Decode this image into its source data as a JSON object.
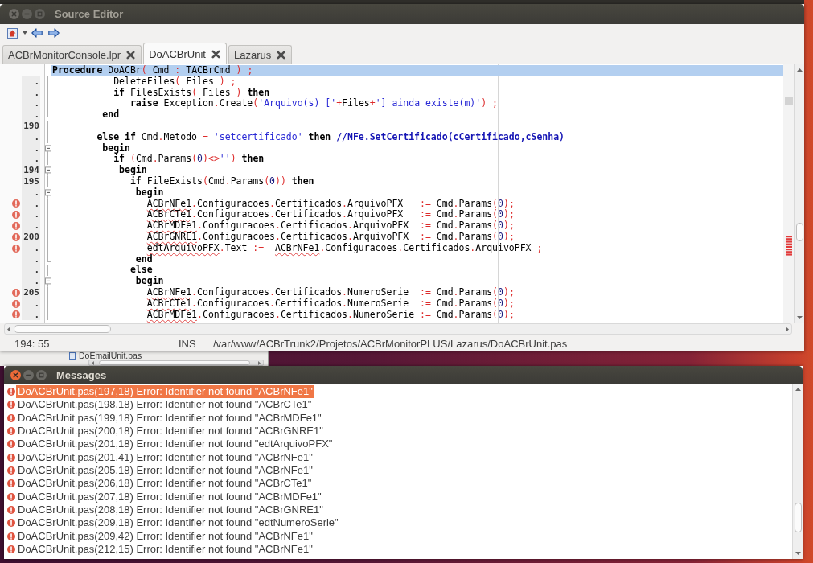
{
  "editor_window": {
    "title": "Source Editor",
    "active": false,
    "tabs": [
      {
        "label": "ACBrMonitorConsole.lpr",
        "selected": false
      },
      {
        "label": "DoACBrUnit",
        "selected": true
      },
      {
        "label": "Lazarus",
        "selected": false
      }
    ],
    "lines": [
      {
        "kind": "plain",
        "error": false,
        "highlighted": true,
        "tokens": [
          {
            "kind": "kw",
            "text": "Procedure"
          },
          {
            "kind": "id",
            "text": " DoACBr"
          },
          {
            "kind": "sym",
            "text": "("
          },
          {
            "kind": "id",
            "text": " Cmd "
          },
          {
            "kind": "sym",
            "text": ":"
          },
          {
            "kind": "id",
            "text": " TACBrCmd "
          },
          {
            "kind": "sym",
            "text": ") ;"
          }
        ]
      },
      {
        "kind": "fold_line",
        "number": ".",
        "error": false,
        "highlighted": false,
        "tokens": [
          {
            "kind": "id",
            "text": "           DeleteFiles"
          },
          {
            "kind": "sym",
            "text": "("
          },
          {
            "kind": "id",
            "text": " Files "
          },
          {
            "kind": "sym",
            "text": ") ;"
          }
        ]
      },
      {
        "kind": "fold_line",
        "number": ".",
        "error": false,
        "highlighted": false,
        "tokens": [
          {
            "kind": "kw",
            "text": "           if"
          },
          {
            "kind": "id",
            "text": " FilesExists"
          },
          {
            "kind": "sym",
            "text": "("
          },
          {
            "kind": "id",
            "text": " Files "
          },
          {
            "kind": "sym",
            "text": ")"
          },
          {
            "kind": "kw",
            "text": " then"
          }
        ]
      },
      {
        "kind": "fold_line",
        "number": ".",
        "error": false,
        "highlighted": false,
        "tokens": [
          {
            "kind": "kw",
            "text": "              raise"
          },
          {
            "kind": "id",
            "text": " Exception"
          },
          {
            "kind": "sym",
            "text": "."
          },
          {
            "kind": "id",
            "text": "Create"
          },
          {
            "kind": "sym",
            "text": "("
          },
          {
            "kind": "str",
            "text": "'Arquivo(s) ['"
          },
          {
            "kind": "sym",
            "text": "+"
          },
          {
            "kind": "id",
            "text": "Files"
          },
          {
            "kind": "sym",
            "text": "+"
          },
          {
            "kind": "str",
            "text": "'] ainda existe(m)'"
          },
          {
            "kind": "sym",
            "text": ") ;"
          }
        ]
      },
      {
        "kind": "fold_end",
        "number": ".",
        "error": false,
        "highlighted": false,
        "tokens": [
          {
            "kind": "kw",
            "text": "         end"
          }
        ]
      },
      {
        "kind": "fold_line",
        "number": "190",
        "error": false,
        "highlighted": false
      },
      {
        "kind": "fold_line",
        "number": ".",
        "error": false,
        "highlighted": false,
        "tokens": [
          {
            "kind": "kw",
            "text": "        else if"
          },
          {
            "kind": "id",
            "text": " Cmd"
          },
          {
            "kind": "sym",
            "text": "."
          },
          {
            "kind": "id",
            "text": "Metodo"
          },
          {
            "kind": "sym",
            "text": " ="
          },
          {
            "kind": "str",
            "text": " 'setcertificado'"
          },
          {
            "kind": "kw",
            "text": " then"
          },
          {
            "kind": "cmt",
            "text": " //NFe.SetCertificado(cCertificado,cSenha)"
          }
        ]
      },
      {
        "kind": "fold_start",
        "number": ".",
        "error": false,
        "highlighted": false,
        "tokens": [
          {
            "kind": "kw",
            "text": "         begin"
          }
        ]
      },
      {
        "kind": "fold_line",
        "number": ".",
        "error": false,
        "highlighted": false,
        "tokens": [
          {
            "kind": "kw",
            "text": "           if"
          },
          {
            "kind": "sym",
            "text": " ("
          },
          {
            "kind": "id",
            "text": "Cmd"
          },
          {
            "kind": "sym",
            "text": "."
          },
          {
            "kind": "id",
            "text": "Params"
          },
          {
            "kind": "sym",
            "text": "("
          },
          {
            "kind": "num",
            "text": "0"
          },
          {
            "kind": "sym",
            "text": ")<>"
          },
          {
            "kind": "str",
            "text": "''"
          },
          {
            "kind": "sym",
            "text": ")"
          },
          {
            "kind": "kw",
            "text": " then"
          }
        ]
      },
      {
        "kind": "fold_start",
        "number": "194",
        "error": false,
        "highlighted": false,
        "tokens": [
          {
            "kind": "kw",
            "text": "            begin"
          }
        ]
      },
      {
        "kind": "fold_line",
        "number": "195",
        "error": false,
        "highlighted": false,
        "tokens": [
          {
            "kind": "kw",
            "text": "              if"
          },
          {
            "kind": "id",
            "text": " FileExists"
          },
          {
            "kind": "sym",
            "text": "("
          },
          {
            "kind": "id",
            "text": "Cmd"
          },
          {
            "kind": "sym",
            "text": "."
          },
          {
            "kind": "id",
            "text": "Params"
          },
          {
            "kind": "sym",
            "text": "("
          },
          {
            "kind": "num",
            "text": "0"
          },
          {
            "kind": "sym",
            "text": "))"
          },
          {
            "kind": "kw",
            "text": " then"
          }
        ]
      },
      {
        "kind": "fold_start",
        "number": ".",
        "error": false,
        "highlighted": false,
        "tokens": [
          {
            "kind": "kw",
            "text": "               begin"
          }
        ]
      },
      {
        "kind": "fold_line",
        "number": ".",
        "error": true,
        "highlighted": false,
        "tokens": [
          {
            "kind": "err",
            "text": "                 ACBrNFe1"
          },
          {
            "kind": "sym",
            "text": "."
          },
          {
            "kind": "id",
            "text": "Configuracoes"
          },
          {
            "kind": "sym",
            "text": "."
          },
          {
            "kind": "id",
            "text": "Certificados"
          },
          {
            "kind": "sym",
            "text": "."
          },
          {
            "kind": "id",
            "text": "ArquivoPFX   "
          },
          {
            "kind": "sym",
            "text": ":="
          },
          {
            "kind": "id",
            "text": " Cmd"
          },
          {
            "kind": "sym",
            "text": "."
          },
          {
            "kind": "id",
            "text": "Params"
          },
          {
            "kind": "sym",
            "text": "("
          },
          {
            "kind": "num",
            "text": "0"
          },
          {
            "kind": "sym",
            "text": ");"
          }
        ]
      },
      {
        "kind": "fold_line",
        "number": ".",
        "error": true,
        "highlighted": false,
        "tokens": [
          {
            "kind": "err",
            "text": "                 ACBrCTe1"
          },
          {
            "kind": "sym",
            "text": "."
          },
          {
            "kind": "id",
            "text": "Configuracoes"
          },
          {
            "kind": "sym",
            "text": "."
          },
          {
            "kind": "id",
            "text": "Certificados"
          },
          {
            "kind": "sym",
            "text": "."
          },
          {
            "kind": "id",
            "text": "ArquivoPFX   "
          },
          {
            "kind": "sym",
            "text": ":="
          },
          {
            "kind": "id",
            "text": " Cmd"
          },
          {
            "kind": "sym",
            "text": "."
          },
          {
            "kind": "id",
            "text": "Params"
          },
          {
            "kind": "sym",
            "text": "("
          },
          {
            "kind": "num",
            "text": "0"
          },
          {
            "kind": "sym",
            "text": ");"
          }
        ]
      },
      {
        "kind": "fold_line",
        "number": ".",
        "error": true,
        "highlighted": false,
        "tokens": [
          {
            "kind": "err",
            "text": "                 ACBrMDFe1"
          },
          {
            "kind": "sym",
            "text": "."
          },
          {
            "kind": "id",
            "text": "Configuracoes"
          },
          {
            "kind": "sym",
            "text": "."
          },
          {
            "kind": "id",
            "text": "Certificados"
          },
          {
            "kind": "sym",
            "text": "."
          },
          {
            "kind": "id",
            "text": "ArquivoPFX  "
          },
          {
            "kind": "sym",
            "text": ":="
          },
          {
            "kind": "id",
            "text": " Cmd"
          },
          {
            "kind": "sym",
            "text": "."
          },
          {
            "kind": "id",
            "text": "Params"
          },
          {
            "kind": "sym",
            "text": "("
          },
          {
            "kind": "num",
            "text": "0"
          },
          {
            "kind": "sym",
            "text": ");"
          }
        ]
      },
      {
        "kind": "fold_line",
        "number": "200",
        "error": true,
        "highlighted": false,
        "tokens": [
          {
            "kind": "err",
            "text": "                 ACBrGNRE1"
          },
          {
            "kind": "sym",
            "text": "."
          },
          {
            "kind": "id",
            "text": "Configuracoes"
          },
          {
            "kind": "sym",
            "text": "."
          },
          {
            "kind": "id",
            "text": "Certificados"
          },
          {
            "kind": "sym",
            "text": "."
          },
          {
            "kind": "id",
            "text": "ArquivoPFX  "
          },
          {
            "kind": "sym",
            "text": ":="
          },
          {
            "kind": "id",
            "text": " Cmd"
          },
          {
            "kind": "sym",
            "text": "."
          },
          {
            "kind": "id",
            "text": "Params"
          },
          {
            "kind": "sym",
            "text": "("
          },
          {
            "kind": "num",
            "text": "0"
          },
          {
            "kind": "sym",
            "text": ");"
          }
        ]
      },
      {
        "kind": "fold_line",
        "number": ".",
        "error": true,
        "highlighted": false,
        "tokens": [
          {
            "kind": "err",
            "text": "                 edtArquivoPFX"
          },
          {
            "kind": "sym",
            "text": "."
          },
          {
            "kind": "id",
            "text": "Text "
          },
          {
            "kind": "sym",
            "text": ":=  "
          },
          {
            "kind": "err",
            "text": "ACBrNFe1"
          },
          {
            "kind": "sym",
            "text": "."
          },
          {
            "kind": "id",
            "text": "Configuracoes"
          },
          {
            "kind": "sym",
            "text": "."
          },
          {
            "kind": "id",
            "text": "Certificados"
          },
          {
            "kind": "sym",
            "text": "."
          },
          {
            "kind": "id",
            "text": "ArquivoPFX"
          },
          {
            "kind": "sym",
            "text": " ;"
          }
        ]
      },
      {
        "kind": "fold_end",
        "number": ".",
        "error": false,
        "highlighted": false,
        "tokens": [
          {
            "kind": "kw",
            "text": "               end"
          }
        ]
      },
      {
        "kind": "fold_line",
        "number": ".",
        "error": false,
        "highlighted": false,
        "tokens": [
          {
            "kind": "kw",
            "text": "              else"
          }
        ]
      },
      {
        "kind": "fold_start",
        "number": ".",
        "error": false,
        "highlighted": false,
        "tokens": [
          {
            "kind": "kw",
            "text": "               begin"
          }
        ]
      },
      {
        "kind": "fold_line",
        "number": "205",
        "error": true,
        "highlighted": false,
        "tokens": [
          {
            "kind": "err",
            "text": "                 ACBrNFe1"
          },
          {
            "kind": "sym",
            "text": "."
          },
          {
            "kind": "id",
            "text": "Configuracoes"
          },
          {
            "kind": "sym",
            "text": "."
          },
          {
            "kind": "id",
            "text": "Certificados"
          },
          {
            "kind": "sym",
            "text": "."
          },
          {
            "kind": "id",
            "text": "NumeroSerie  "
          },
          {
            "kind": "sym",
            "text": ":="
          },
          {
            "kind": "id",
            "text": " Cmd"
          },
          {
            "kind": "sym",
            "text": "."
          },
          {
            "kind": "id",
            "text": "Params"
          },
          {
            "kind": "sym",
            "text": "("
          },
          {
            "kind": "num",
            "text": "0"
          },
          {
            "kind": "sym",
            "text": ");"
          }
        ]
      },
      {
        "kind": "fold_line",
        "number": ".",
        "error": true,
        "highlighted": false,
        "tokens": [
          {
            "kind": "err",
            "text": "                 ACBrCTe1"
          },
          {
            "kind": "sym",
            "text": "."
          },
          {
            "kind": "id",
            "text": "Configuracoes"
          },
          {
            "kind": "sym",
            "text": "."
          },
          {
            "kind": "id",
            "text": "Certificados"
          },
          {
            "kind": "sym",
            "text": "."
          },
          {
            "kind": "id",
            "text": "NumeroSerie  "
          },
          {
            "kind": "sym",
            "text": ":="
          },
          {
            "kind": "id",
            "text": " Cmd"
          },
          {
            "kind": "sym",
            "text": "."
          },
          {
            "kind": "id",
            "text": "Params"
          },
          {
            "kind": "sym",
            "text": "("
          },
          {
            "kind": "num",
            "text": "0"
          },
          {
            "kind": "sym",
            "text": ");"
          }
        ]
      },
      {
        "kind": "fold_line",
        "number": ".",
        "error": true,
        "highlighted": false,
        "tokens": [
          {
            "kind": "err",
            "text": "                 ACBrMDFe1"
          },
          {
            "kind": "sym",
            "text": "."
          },
          {
            "kind": "id",
            "text": "Configuracoes"
          },
          {
            "kind": "sym",
            "text": "."
          },
          {
            "kind": "id",
            "text": "Certificados"
          },
          {
            "kind": "sym",
            "text": "."
          },
          {
            "kind": "id",
            "text": "NumeroSerie "
          },
          {
            "kind": "sym",
            "text": ":="
          },
          {
            "kind": "id",
            "text": " Cmd"
          },
          {
            "kind": "sym",
            "text": "."
          },
          {
            "kind": "id",
            "text": "Params"
          },
          {
            "kind": "sym",
            "text": "("
          },
          {
            "kind": "num",
            "text": "0"
          },
          {
            "kind": "sym",
            "text": ");"
          }
        ]
      }
    ],
    "status_bar": {
      "position": "194: 55",
      "mode": "INS",
      "file_path": "/var/www/ACBrTrunk2/Projetos/ACBrMonitorPLUS/Lazarus/DoACBrUnit.pas"
    }
  },
  "background_window": {
    "file_item": "DoEmailUnit.pas"
  },
  "messages_window": {
    "title": "Messages",
    "active": true,
    "items": [
      {
        "text": "DoACBrUnit.pas(197,18) Error: Identifier not found \"ACBrNFe1\"",
        "selected": true
      },
      {
        "text": "DoACBrUnit.pas(198,18) Error: Identifier not found \"ACBrCTe1\"",
        "selected": false
      },
      {
        "text": "DoACBrUnit.pas(199,18) Error: Identifier not found \"ACBrMDFe1\"",
        "selected": false
      },
      {
        "text": "DoACBrUnit.pas(200,18) Error: Identifier not found \"ACBrGNRE1\"",
        "selected": false
      },
      {
        "text": "DoACBrUnit.pas(201,18) Error: Identifier not found \"edtArquivoPFX\"",
        "selected": false
      },
      {
        "text": "DoACBrUnit.pas(201,41) Error: Identifier not found \"ACBrNFe1\"",
        "selected": false
      },
      {
        "text": "DoACBrUnit.pas(205,18) Error: Identifier not found \"ACBrNFe1\"",
        "selected": false
      },
      {
        "text": "DoACBrUnit.pas(206,18) Error: Identifier not found \"ACBrCTe1\"",
        "selected": false
      },
      {
        "text": "DoACBrUnit.pas(207,18) Error: Identifier not found \"ACBrMDFe1\"",
        "selected": false
      },
      {
        "text": "DoACBrUnit.pas(208,18) Error: Identifier not found \"ACBrGNRE1\"",
        "selected": false
      },
      {
        "text": "DoACBrUnit.pas(209,18) Error: Identifier not found \"edtNumeroSerie\"",
        "selected": false
      },
      {
        "text": "DoACBrUnit.pas(209,42) Error: Identifier not found \"ACBrNFe1\"",
        "selected": false
      },
      {
        "text": "DoACBrUnit.pas(212,15) Error: Identifier not found \"ACBrNFe1\"",
        "selected": false
      }
    ]
  }
}
